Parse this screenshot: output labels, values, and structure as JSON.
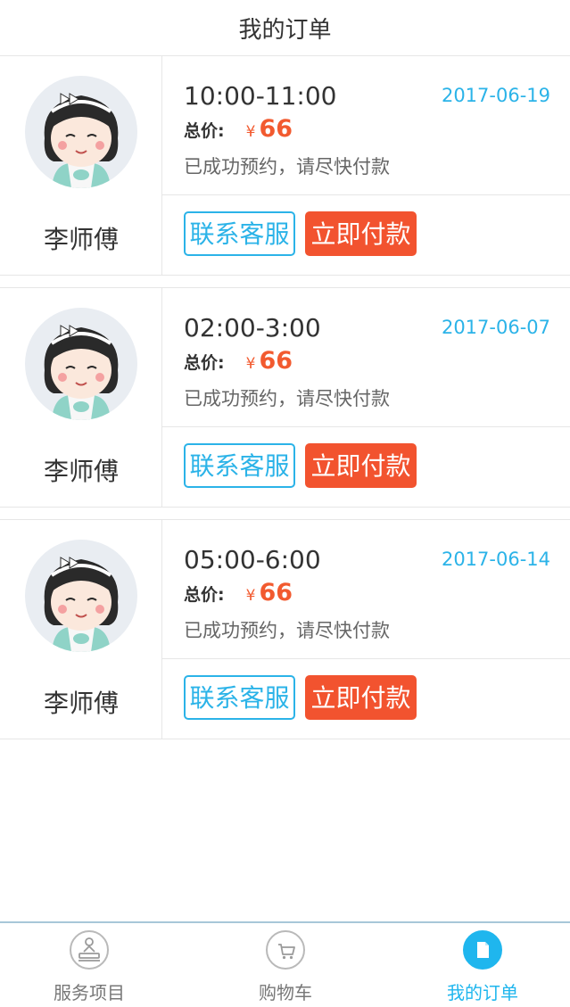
{
  "header": {
    "title": "我的订单"
  },
  "orders": [
    {
      "technician": "李师傅",
      "time_range": "10:00-11:00",
      "date": "2017-06-19",
      "price_label": "总价:",
      "currency": "¥",
      "price": "66",
      "status": "已成功预约，请尽快付款",
      "contact_label": "联系客服",
      "pay_label": "立即付款"
    },
    {
      "technician": "李师傅",
      "time_range": "02:00-3:00",
      "date": "2017-06-07",
      "price_label": "总价:",
      "currency": "¥",
      "price": "66",
      "status": "已成功预约，请尽快付款",
      "contact_label": "联系客服",
      "pay_label": "立即付款"
    },
    {
      "technician": "李师傅",
      "time_range": "05:00-6:00",
      "date": "2017-06-14",
      "price_label": "总价:",
      "currency": "¥",
      "price": "66",
      "status": "已成功预约，请尽快付款",
      "contact_label": "联系客服",
      "pay_label": "立即付款"
    }
  ],
  "tabbar": {
    "tabs": [
      {
        "label": "服务项目",
        "icon": "massage-icon"
      },
      {
        "label": "购物车",
        "icon": "cart-icon"
      },
      {
        "label": "我的订单",
        "icon": "document-icon",
        "active": true
      }
    ]
  },
  "colors": {
    "accent": "#1fb6ee",
    "pay": "#f2532f",
    "price": "#f25a2f",
    "date": "#2bb3e8"
  }
}
